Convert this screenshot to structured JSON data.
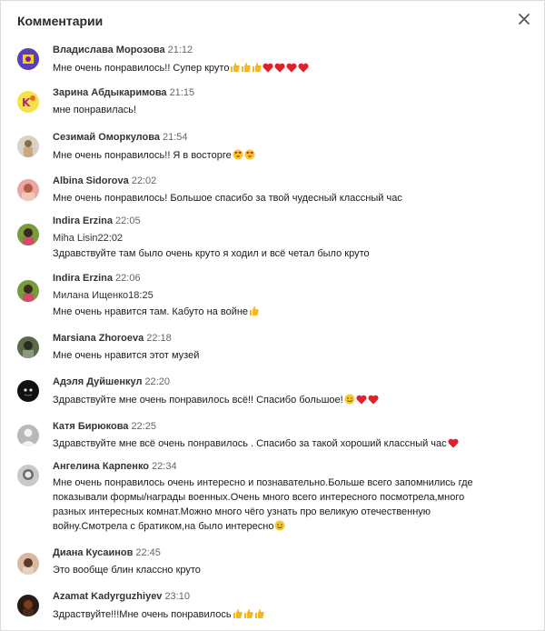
{
  "header": {
    "title": "Комментарии",
    "close_icon": "close-icon"
  },
  "comments": [
    {
      "author": "Владислава Морозова",
      "time": "21:12",
      "text": "Мне очень понравилось!! Супер круто",
      "emoji": [
        "thumbs-up",
        "thumbs-up",
        "thumbs-up",
        "heart",
        "heart",
        "heart",
        "heart"
      ]
    },
    {
      "author": "Зарина Абдыкаримова",
      "time": "21:15",
      "text": "мне понравилась!"
    },
    {
      "author": "Сезимай Оморкулова",
      "time": "21:54",
      "text": "Мне очень понравилось!! Я в восторге",
      "emoji": [
        "heart-eyes",
        "heart-eyes"
      ]
    },
    {
      "author": "Albina Sidorova",
      "time": "22:02",
      "text": "Мне очень понравилось! Большое спасибо за твой чудесный классный час"
    },
    {
      "author": "Indira Erzina",
      "time": "22:05",
      "quote": "Miha Lisin22:02",
      "text": "Здравствуйте там было очень круто я ходил и всё четал было круто"
    },
    {
      "author": "Indira Erzina",
      "time": "22:06",
      "quote": "Милана Ищенко18:25",
      "text": "Мне очень нравится там. Кабуто на войне",
      "emoji": [
        "thumbs-up"
      ]
    },
    {
      "author": "Marsiana Zhoroeva",
      "time": "22:18",
      "text": "Мне очень нравится этот музей"
    },
    {
      "author": "Адэля Дуйшенкул",
      "time": "22:20",
      "text": "Здравствуйте мне очень понравилось всё!! Спасибо большое!",
      "emoji": [
        "smile",
        "heart",
        "heart"
      ]
    },
    {
      "author": "Катя Бирюкова",
      "time": "22:25",
      "text": "Здравствуйте мне всё очень понравилось . Спасибо за такой хороший классный час",
      "emoji": [
        "heart"
      ]
    },
    {
      "author": "Ангелина Карпенко",
      "time": "22:34",
      "text": "Мне очень понравилось очень интересно и познавательно.Больше всего запомнились где показывали формы/награды военных.Очень много всего интересного посмотрела,много разных интересных комнат.Можно много чёго узнать про великую отечественную войну.Смотрела с братиком,на было интересно",
      "emoji": [
        "smile"
      ]
    },
    {
      "author": "Диана Кусаинов",
      "time": "22:45",
      "text": "Это вообще блин классно круто"
    },
    {
      "author": "Azamat Kadyrguzhiyev",
      "time": "23:10",
      "text": "Здраствуйте!!!Мне очень понравилось",
      "emoji": [
        "thumbs-up",
        "thumbs-up",
        "thumbs-up"
      ]
    }
  ],
  "colors": {
    "heart": "#e0202a",
    "thumb": "#f5b822",
    "face": "#f8c92f"
  }
}
